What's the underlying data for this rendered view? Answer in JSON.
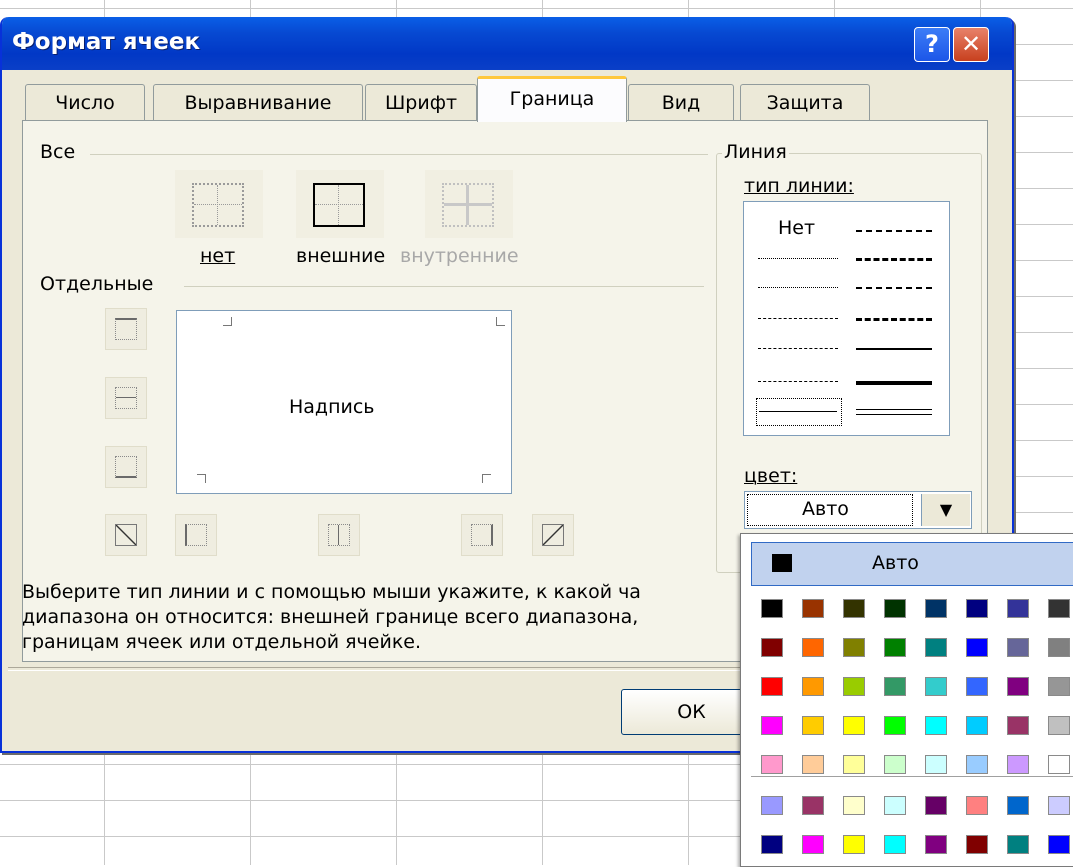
{
  "window": {
    "title": "Формат ячеек",
    "help_label": "?",
    "close_label": "✕"
  },
  "tabs": [
    {
      "label": "Число"
    },
    {
      "label": "Выравнивание"
    },
    {
      "label": "Шрифт"
    },
    {
      "label": "Граница",
      "active": true
    },
    {
      "label": "Вид"
    },
    {
      "label": "Защита"
    }
  ],
  "presets": {
    "group_label": "Все",
    "none_label": "нет",
    "outline_label": "внешние",
    "inside_label": "внутренние"
  },
  "border": {
    "group_label": "Отдельные",
    "preview_text": "Надпись"
  },
  "line": {
    "group_label": "Линия",
    "style_label": "тип линии:",
    "none_style_label": "Нет",
    "color_label": "цвет:",
    "color_value": "Авто",
    "dropdown_arrow": "▼"
  },
  "description": "Выберите тип линии и с помощью мыши укажите, к какой ча диапазона он относится: внешней границе всего диапазона, границам ячеек или отдельной ячейке.",
  "description_lines": [
    "Выберите тип линии и с помощью мыши укажите, к какой ча",
    "диапазона он относится: внешней границе всего диапазона,",
    "границам ячеек или отдельной ячейке."
  ],
  "buttons": {
    "ok": "ОК"
  },
  "palette": {
    "auto_label": "Авто",
    "auto_color": "#000000",
    "rows": [
      [
        "#000000",
        "#993300",
        "#333300",
        "#003300",
        "#003366",
        "#000080",
        "#333399",
        "#333333"
      ],
      [
        "#800000",
        "#FF6600",
        "#808000",
        "#008000",
        "#008080",
        "#0000FF",
        "#666699",
        "#808080"
      ],
      [
        "#FF0000",
        "#FF9900",
        "#99CC00",
        "#339966",
        "#33CCCC",
        "#3366FF",
        "#800080",
        "#969696"
      ],
      [
        "#FF00FF",
        "#FFCC00",
        "#FFFF00",
        "#00FF00",
        "#00FFFF",
        "#00CCFF",
        "#993366",
        "#C0C0C0"
      ],
      [
        "#FF99CC",
        "#FFCC99",
        "#FFFF99",
        "#CCFFCC",
        "#CCFFFF",
        "#99CCFF",
        "#CC99FF",
        "#FFFFFF"
      ]
    ],
    "extra_rows": [
      [
        "#9999FF",
        "#993366",
        "#FFFFCC",
        "#CCFFFF",
        "#660066",
        "#FF8080",
        "#0066CC",
        "#CCCCFF"
      ],
      [
        "#000080",
        "#FF00FF",
        "#FFFF00",
        "#00FFFF",
        "#800080",
        "#800000",
        "#008080",
        "#0000FF"
      ]
    ]
  }
}
